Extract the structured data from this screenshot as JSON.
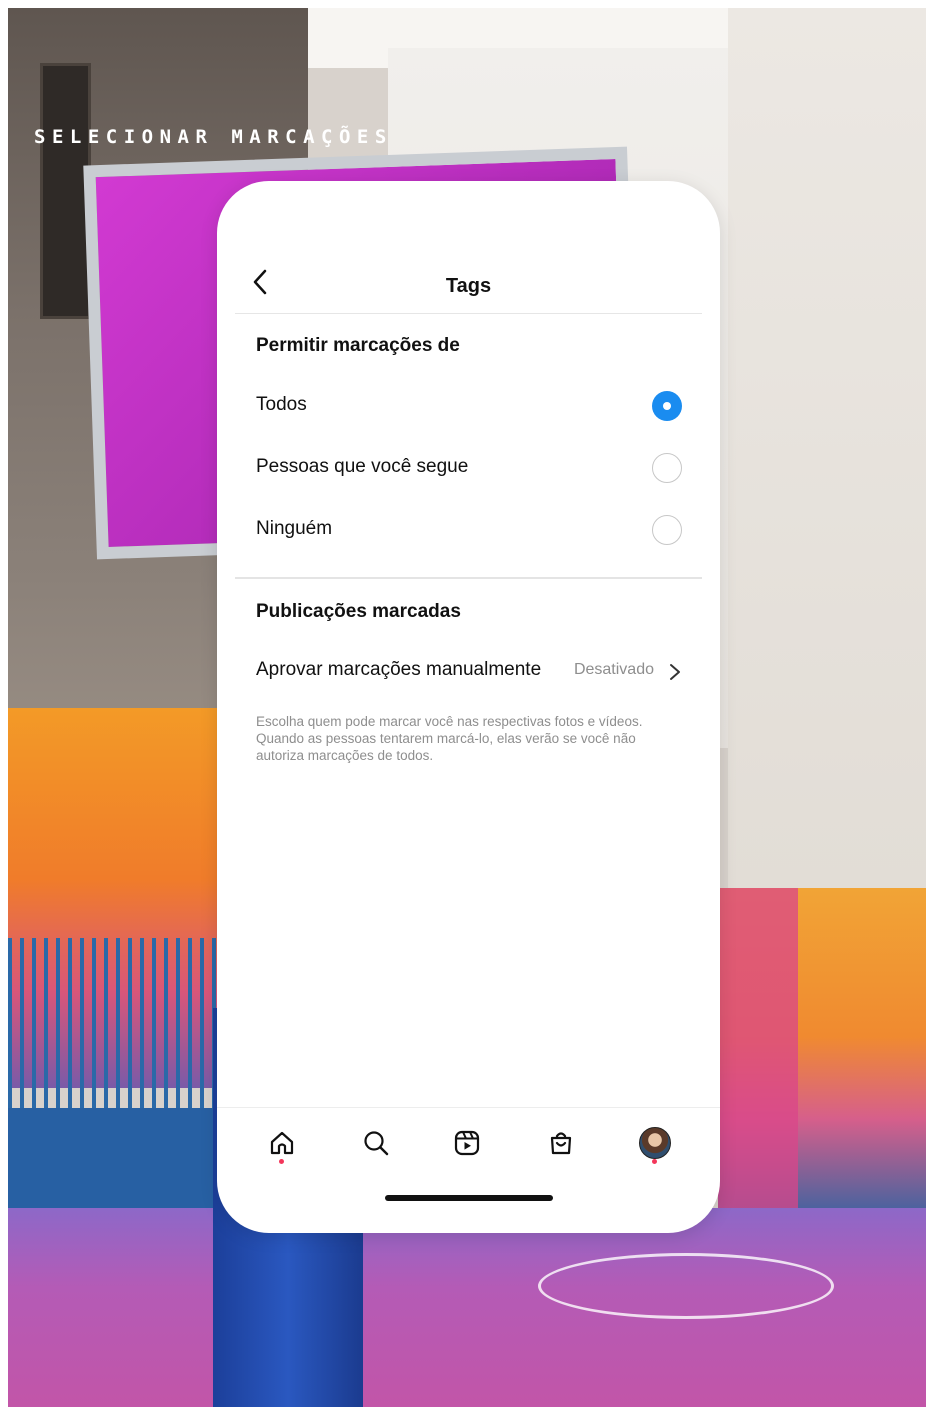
{
  "overlay_label": "SELECIONAR MARCAÇÕES",
  "header": {
    "title": "Tags"
  },
  "permit_section": {
    "title": "Permitir marcações de",
    "options": [
      {
        "label": "Todos",
        "selected": true
      },
      {
        "label": "Pessoas que você segue",
        "selected": false
      },
      {
        "label": "Ninguém",
        "selected": false
      }
    ]
  },
  "tagged_section": {
    "title": "Publicações marcadas",
    "approve_label": "Aprovar marcações manualmente",
    "approve_status": "Desativado",
    "help_text": "Escolha quem pode marcar você nas respectivas fotos e vídeos. Quando as pessoas tentarem marcá-lo, elas verão se você não autoriza marcações de todos."
  },
  "tabbar": {
    "tabs": [
      "home-icon",
      "search-icon",
      "reels-icon",
      "shop-icon",
      "profile-avatar"
    ],
    "notification_dot_color": "#f3365a"
  },
  "colors": {
    "accent": "#1a8cf0",
    "secondary_text": "#8e8e8e"
  }
}
